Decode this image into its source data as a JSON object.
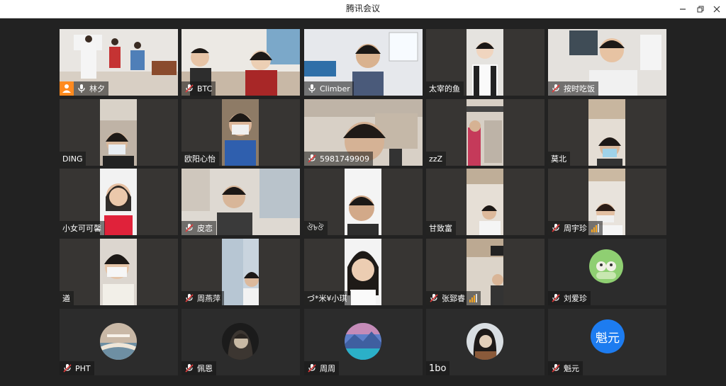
{
  "window": {
    "title": "腾讯会议",
    "minimize_icon": "minimize-icon",
    "restore_icon": "restore-icon",
    "close_icon": "close-icon"
  },
  "participants": [
    {
      "name": "林夕",
      "mic": "on",
      "host": true
    },
    {
      "name": "BTC",
      "mic": "muted"
    },
    {
      "name": "Climber",
      "mic": "on"
    },
    {
      "name": "太宰的鱼",
      "mic": "none"
    },
    {
      "name": "按时吃饭",
      "mic": "muted"
    },
    {
      "name": "DING",
      "mic": "none"
    },
    {
      "name": "欧阳心怡",
      "mic": "none"
    },
    {
      "name": "5981749909",
      "mic": "muted"
    },
    {
      "name": "zzZ",
      "mic": "none"
    },
    {
      "name": "莫北",
      "mic": "none"
    },
    {
      "name": "小女可可馨",
      "mic": "none"
    },
    {
      "name": "皮恋",
      "mic": "muted"
    },
    {
      "name": "ঔ৳ঔ",
      "mic": "none"
    },
    {
      "name": "甘致富",
      "mic": "none"
    },
    {
      "name": "周宇珍",
      "mic": "muted",
      "signal": true
    },
    {
      "name": "遒",
      "mic": "none"
    },
    {
      "name": "周燕萍",
      "mic": "muted"
    },
    {
      "name": "づ*米¥小琪",
      "mic": "none"
    },
    {
      "name": "张郅睿",
      "mic": "muted",
      "signal": true
    },
    {
      "name": "刘爱珍",
      "mic": "muted"
    },
    {
      "name": "PHT",
      "mic": "muted"
    },
    {
      "name": "佩恩",
      "mic": "muted"
    },
    {
      "name": "周周",
      "mic": "muted"
    },
    {
      "name": "1bo",
      "mic": "none"
    },
    {
      "name": "魁元",
      "mic": "muted"
    }
  ],
  "avatar_text": {
    "kuiyuan": "魁元"
  },
  "colors": {
    "tile_bg": "#373533",
    "window_bg": "#222222",
    "avatar_blue": "#1d7cf0",
    "host_orange": "#ff8a1f"
  }
}
